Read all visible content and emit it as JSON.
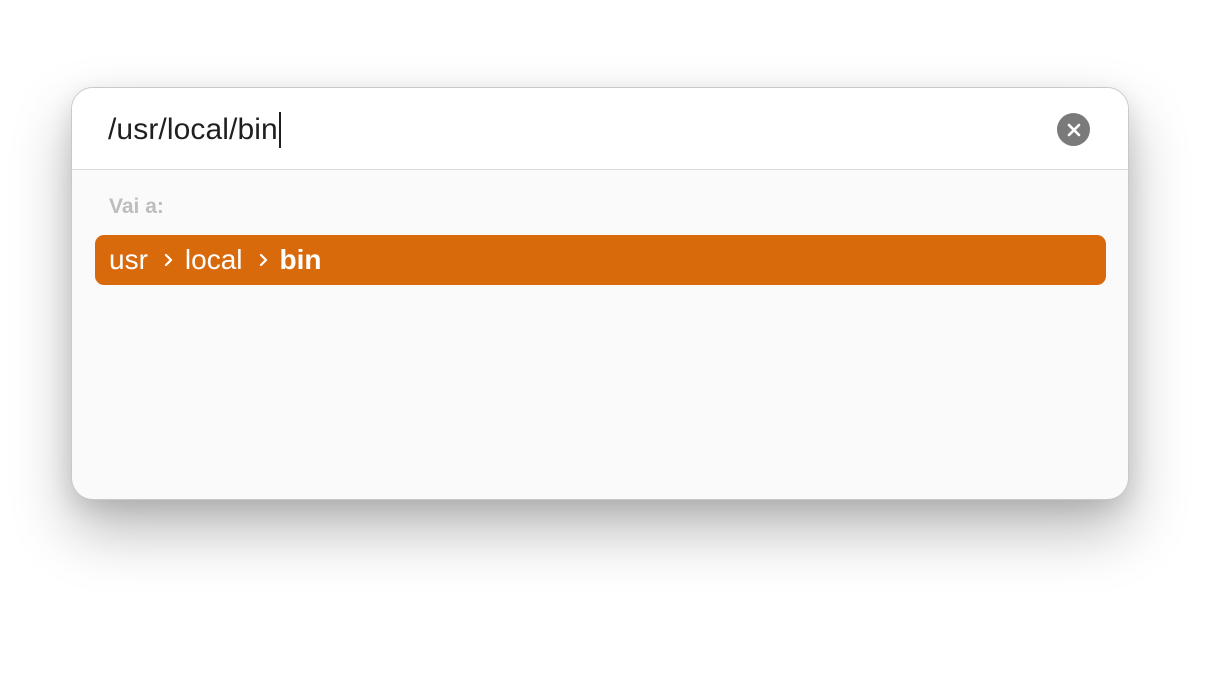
{
  "search": {
    "value": "/usr/local/bin"
  },
  "icons": {
    "clear": "clear-circle-x-icon",
    "separator": "chevron-right-icon"
  },
  "colors": {
    "accent": "#d96a0c",
    "clear_button": "#7a7a7a",
    "section_label": "#bdbdbd"
  },
  "results": {
    "section_label": "Vai a:",
    "items": [
      {
        "crumbs": [
          "usr",
          "local",
          "bin"
        ]
      }
    ]
  }
}
